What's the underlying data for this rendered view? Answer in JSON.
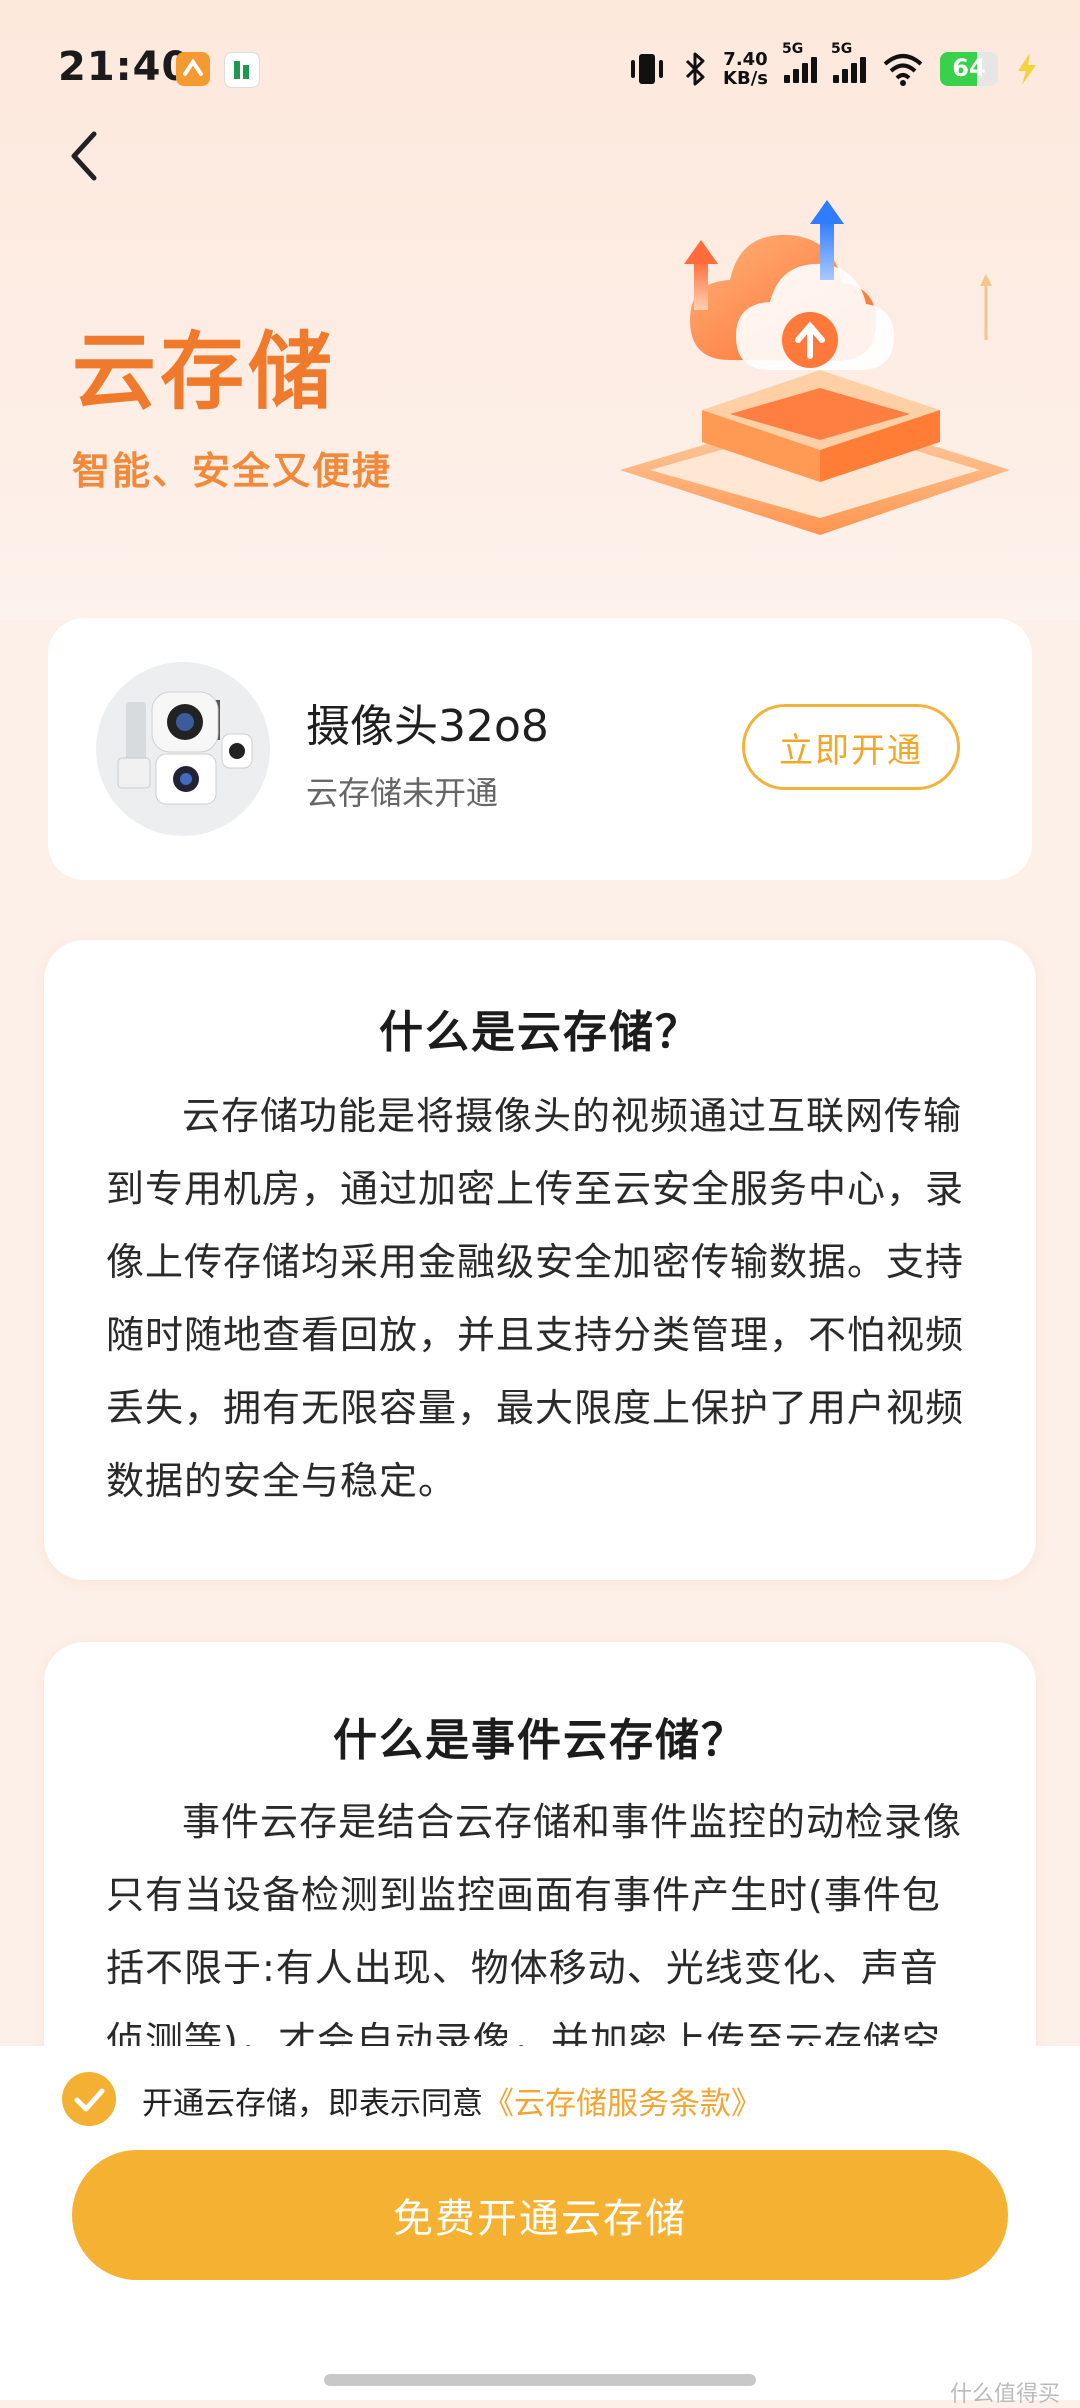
{
  "status_bar": {
    "time": "21:40",
    "net_speed_value": "7.40",
    "net_speed_unit": "KB/s",
    "signal1_label": "5G",
    "signal2_label": "5G",
    "battery_level": "64"
  },
  "header": {
    "title": "云存储",
    "subtitle": "智能、安全又便捷"
  },
  "device": {
    "name": "摄像头32o8",
    "status": "云存储未开通",
    "open_label": "立即开通"
  },
  "intro": {
    "title": "什么是云存储？",
    "body": "云存储功能是将摄像头的视频通过互联网传输到专用机房，通过加密上传至云安全服务中心，录像上传存储均采用金融级安全加密传输数据。支持随时随地查看回放，并且支持分类管理，不怕视频丢失，拥有无限容量，最大限度上保护了用户视频数据的安全与稳定。"
  },
  "event": {
    "title": "什么是事件云存储？",
    "body": "事件云存是结合云存储和事件监控的动检录像只有当设备检测到监控画面有事件产生时(事件包括不限于:有人出现、物体移动、光线变化、声音侦测等)，才会自动录像，并加密上传至云存储空间，事"
  },
  "footer": {
    "agree_prefix": "开通云存储，即表示同意",
    "agree_link": "《云存储服务条款》",
    "cta_label": "免费开通云存储",
    "watermark": "什么值得买"
  },
  "colors": {
    "accent": "#f5b132",
    "title_orange": "#f07a2b"
  }
}
